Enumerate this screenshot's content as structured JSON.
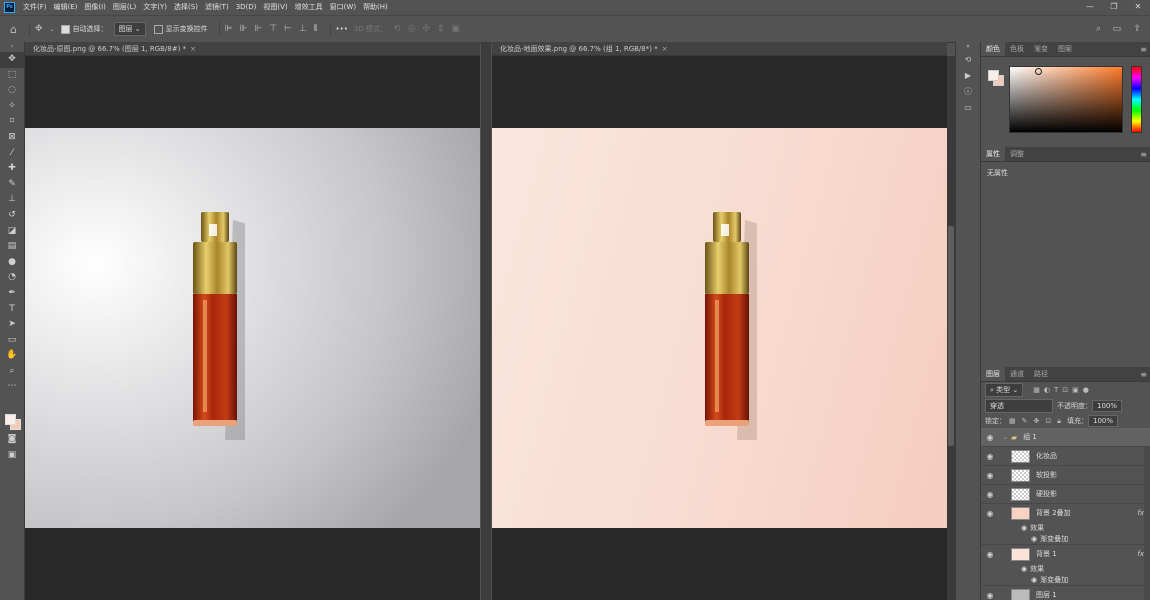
{
  "app": {
    "logo": "Ps"
  },
  "menu": [
    "文件(F)",
    "编辑(E)",
    "图像(I)",
    "图层(L)",
    "文字(Y)",
    "选择(S)",
    "滤镜(T)",
    "3D(D)",
    "视图(V)",
    "增效工具",
    "窗口(W)",
    "帮助(H)"
  ],
  "window_controls": {
    "minimize": "—",
    "restore": "❐",
    "close": "✕"
  },
  "options": {
    "auto_select_label": "自动选择：",
    "auto_select_value": "图层",
    "show_transform_label": "显示变换控件",
    "mode_3d": "3D 模式：",
    "more": "•••"
  },
  "documents": [
    {
      "tab": "化妆品-原图.png @ 66.7% (图层 1, RGB/8#) *",
      "close": "×"
    },
    {
      "tab": "化妆品-地面效果.png @ 66.7% (组 1, RGB/8*) *",
      "close": "×"
    }
  ],
  "panels": {
    "color_tabs": [
      "颜色",
      "色板",
      "渐变",
      "图案"
    ],
    "properties_tabs": [
      "属性",
      "调整"
    ],
    "properties_empty": "无属性",
    "layers_tabs": [
      "图层",
      "通道",
      "路径"
    ],
    "filter_kind": "类型",
    "blend_mode": "穿透",
    "opacity_label": "不透明度：",
    "opacity_value": "100%",
    "lock_label": "锁定：",
    "fill_label": "填充：",
    "fill_value": "100%"
  },
  "layers": [
    {
      "name": "组 1",
      "type": "group"
    },
    {
      "name": "化妆品",
      "type": "layer",
      "thumb": "checker"
    },
    {
      "name": "软投影",
      "type": "layer",
      "thumb": "checker"
    },
    {
      "name": "硬投影",
      "type": "layer",
      "thumb": "checker"
    },
    {
      "name": "背景 2叠加",
      "type": "layer",
      "thumb": "#f8d3c4",
      "fx": "fx",
      "effects_label": "效果",
      "effect": "渐变叠加"
    },
    {
      "name": "背景 1",
      "type": "layer",
      "thumb": "#fbe3da",
      "fx": "fx",
      "effects_label": "效果",
      "effect": "渐变叠加"
    },
    {
      "name": "图层 1",
      "type": "layer",
      "thumb": "#bbbbbb"
    }
  ],
  "colors": {
    "foreground": "#faeee8",
    "background": "#f3cab7",
    "accent": "#31a8ff"
  }
}
